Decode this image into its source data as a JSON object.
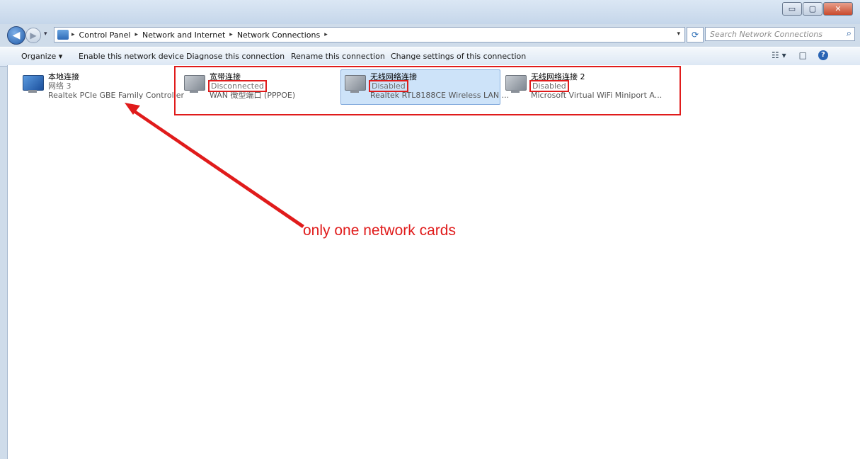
{
  "window": {
    "min_glyph": "▭",
    "max_glyph": "▢",
    "close_glyph": "✕"
  },
  "nav": {
    "back_glyph": "◀",
    "forward_glyph": "▶",
    "recent_glyph": "▾",
    "refresh_glyph": "⟳",
    "breadcrumb": [
      "Control Panel",
      "Network and Internet",
      "Network Connections"
    ],
    "breadcrumb_separator": "▸",
    "search_placeholder": "Search Network Connections",
    "search_icon": "search-icon"
  },
  "toolbar": {
    "organize": "Organize ▾",
    "enable": "Enable this network device",
    "diagnose": "Diagnose this connection",
    "rename": "Rename this connection",
    "change": "Change settings of this connection",
    "views_glyph": "☷ ▾",
    "pane_glyph": "□",
    "help_glyph": "?"
  },
  "connections": [
    {
      "name": "本地连接",
      "status": "网络 3",
      "device": "Realtek PCIe GBE Family Controller",
      "icon": "network-adapter-icon",
      "color": "blue"
    },
    {
      "name": "宽带连接",
      "status": "Disconnected",
      "device": "WAN 微型端口 (PPPOE)",
      "icon": "broadband-icon",
      "color": "gray"
    },
    {
      "name": "无线网络连接",
      "status": "Disabled",
      "device": "Realtek RTL8188CE Wireless LAN ...",
      "icon": "wireless-icon",
      "color": "gray"
    },
    {
      "name": "无线网络连接 2",
      "status": "Disabled",
      "device": "Microsoft Virtual WiFi Miniport A...",
      "icon": "wireless-icon",
      "color": "gray"
    }
  ],
  "annotation": {
    "text": "only one network cards",
    "color": "#e01b1b"
  }
}
